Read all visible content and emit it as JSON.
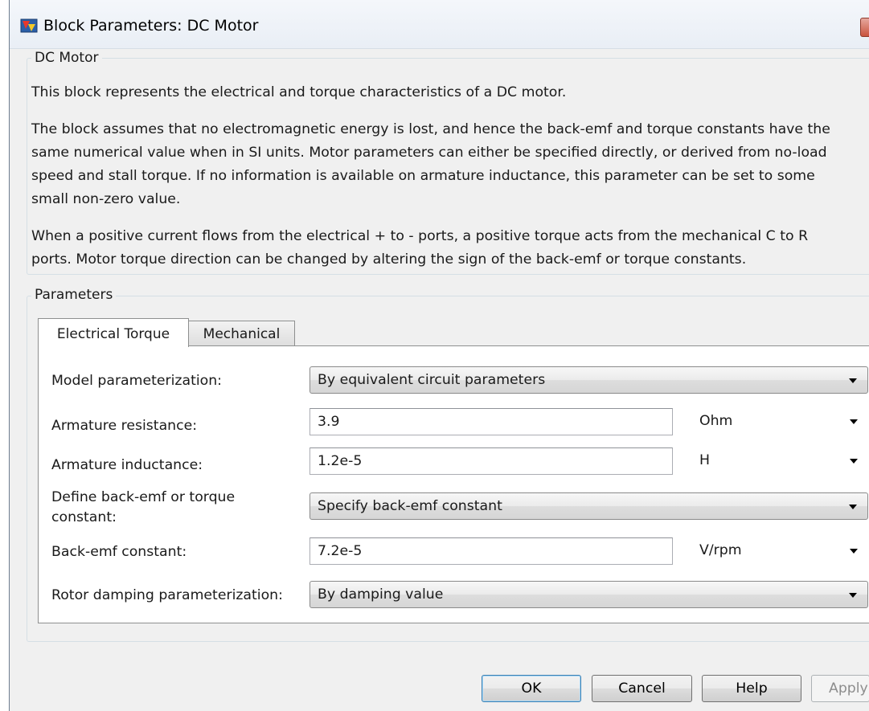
{
  "window": {
    "title": "Block Parameters: DC Motor"
  },
  "block_group": {
    "legend": "DC Motor",
    "description": [
      "This block represents the electrical and torque characteristics of a DC motor.",
      "The block assumes that no electromagnetic energy is lost, and hence the back-emf and torque constants have the",
      "same numerical value when in SI units. Motor parameters can either be specified directly, or derived from no-load",
      "speed and stall torque. If no information is available on armature inductance, this parameter can be set to some",
      "small non-zero value.",
      "When a positive current flows from the electrical + to - ports, a positive torque acts from the mechanical C to R",
      "ports. Motor torque direction can be changed by altering the sign of the back-emf or torque constants."
    ]
  },
  "parameters_group": {
    "legend": "Parameters",
    "tabs": [
      {
        "label": "Electrical Torque",
        "active": true
      },
      {
        "label": "Mechanical",
        "active": false
      }
    ]
  },
  "fields": {
    "model_parameterization": {
      "label": "Model parameterization:",
      "value": "By equivalent circuit parameters"
    },
    "armature_resistance": {
      "label": "Armature resistance:",
      "value": "3.9",
      "unit": "Ohm"
    },
    "armature_inductance": {
      "label": "Armature inductance:",
      "value": "1.2e-5",
      "unit": "H"
    },
    "define_constant": {
      "label_line1": "Define back-emf or torque",
      "label_line2": "constant:",
      "value": "Specify back-emf constant"
    },
    "back_emf_constant": {
      "label": "Back-emf constant:",
      "value": "7.2e-5",
      "unit": "V/rpm"
    },
    "rotor_damping": {
      "label": "Rotor damping parameterization:",
      "value": "By damping value"
    }
  },
  "buttons": {
    "ok": "OK",
    "cancel": "Cancel",
    "help": "Help",
    "apply": "Apply"
  },
  "icons": {
    "app": "simulink-block-icon",
    "close": "close-icon",
    "dropdown": "chevron-down-icon"
  },
  "colors": {
    "window_bg": "#f0f0f0",
    "panel_bg": "#ffffff",
    "default_button_border": "#3c7fb1",
    "close_button": "#c9533e"
  }
}
